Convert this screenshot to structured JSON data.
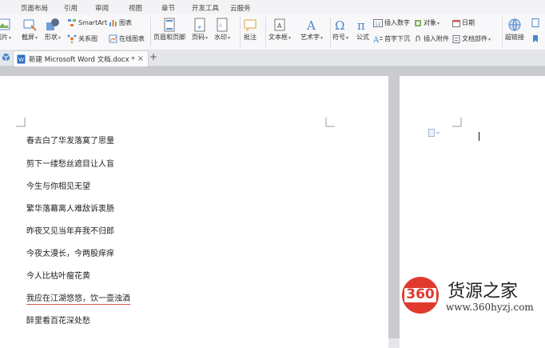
{
  "menu": [
    "页面布局",
    "引用",
    "审阅",
    "视图",
    "章节",
    "开发工具",
    "云服务"
  ],
  "ribbon": {
    "picture": "图片",
    "screenshot": "截屏",
    "shape": "形状",
    "smartart": "SmartArt",
    "chart": "图表",
    "relation": "关系图",
    "online_chart": "在线图表",
    "header_footer": "页眉和页脚",
    "page_number": "页码",
    "watermark": "水印",
    "comment": "批注",
    "textbox": "文本框",
    "wordart": "艺术字",
    "symbol": "符号",
    "formula": "公式",
    "insert_number": "插入数字",
    "object": "对象",
    "date": "日期",
    "first_letter": "首字下沉",
    "attachment": "插入附件",
    "doc_part": "文档部件",
    "hyperlink": "超链接"
  },
  "tab": {
    "title": "新建 Microsoft Word 文档.docx *",
    "close": "×",
    "add": "+"
  },
  "document": {
    "lines": [
      "春去白了华发落寞了思量",
      "剪下一缕愁丝遮目让人盲",
      "今生与你相见无望",
      "繁华落幕离人难敌诉衷肠",
      "昨夜又见当年弃我不归郎",
      "今夜太漫长，今两股痒痒",
      "今人比枯叶瘦花黄",
      "我应在江湖悠悠，饮一壶浊酒",
      "醉里看百花深处愁"
    ]
  },
  "watermark": {
    "badge": "360",
    "name": "货源之家",
    "url": "www.360hyzj.com"
  }
}
